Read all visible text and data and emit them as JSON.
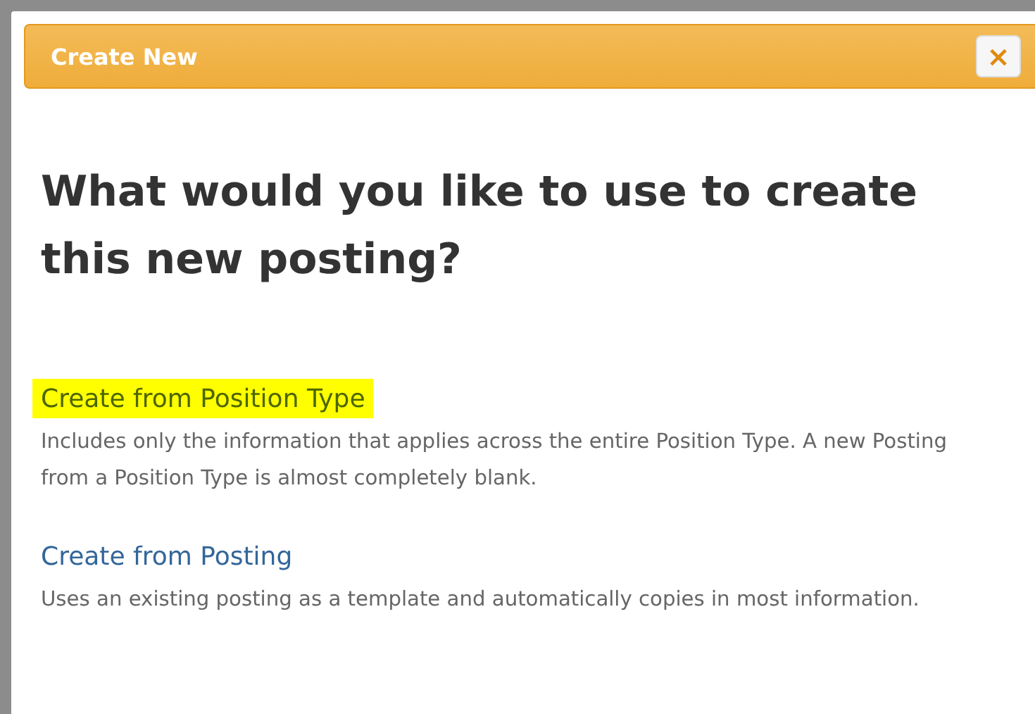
{
  "dialog": {
    "title": "Create New",
    "close_button": "×"
  },
  "heading": "What would you like to use to create this new posting?",
  "options": [
    {
      "label": "Create from Position Type",
      "description": "Includes only the information that applies across the entire Position Type. A new Posting from a Position Type is almost completely blank.",
      "highlighted": true
    },
    {
      "label": "Create from Posting",
      "description": "Uses an existing posting as a template and automatically copies in most information.",
      "highlighted": false
    }
  ]
}
